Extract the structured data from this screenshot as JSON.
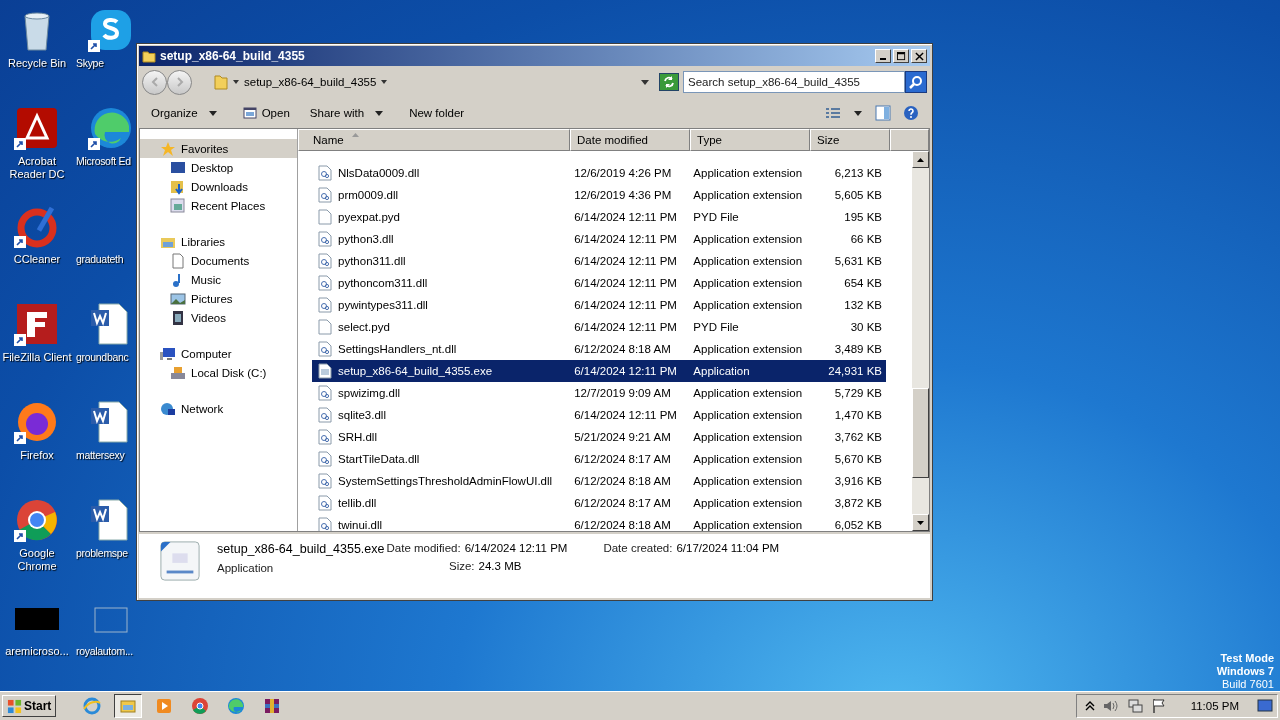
{
  "desktop": {
    "columns": [
      [
        {
          "label": "Recycle Bin",
          "kind": "recycle",
          "shortcut": false
        },
        {
          "label": "Acrobat Reader DC",
          "kind": "acrobat",
          "shortcut": true
        },
        {
          "label": "CCleaner",
          "kind": "ccleaner",
          "shortcut": true
        },
        {
          "label": "FileZilla Client",
          "kind": "filezilla",
          "shortcut": true
        },
        {
          "label": "Firefox",
          "kind": "firefox",
          "shortcut": true
        },
        {
          "label": "Google Chrome",
          "kind": "chrome",
          "shortcut": true
        },
        {
          "label": "aremicroso...",
          "kind": "black",
          "shortcut": false
        }
      ],
      [
        {
          "label": "Skype",
          "kind": "skype",
          "shortcut": true
        },
        {
          "label": "Microsoft Ed",
          "kind": "edge",
          "shortcut": true
        },
        {
          "label": "graduateth",
          "kind": "none",
          "shortcut": false
        },
        {
          "label": "groundbanc",
          "kind": "word",
          "shortcut": false
        },
        {
          "label": "mattersexy",
          "kind": "word",
          "shortcut": false
        },
        {
          "label": "problemspe",
          "kind": "word",
          "shortcut": false
        },
        {
          "label": "royalautom...",
          "kind": "blank",
          "shortcut": false
        }
      ]
    ],
    "watermark_text": [
      "Test Mode",
      "Windows 7",
      "Build 7601"
    ]
  },
  "window": {
    "title": "setup_x86-64_build_4355",
    "address": "setup_x86-64_build_4355",
    "search": {
      "placeholder": "Search setup_x86-64_build_4355"
    },
    "toolbar": [
      {
        "label": "Organize",
        "dropdown": true,
        "kind": "text"
      },
      {
        "label": "Open",
        "dropdown": false,
        "kind": "open"
      },
      {
        "label": "Share with",
        "dropdown": true,
        "kind": "text"
      },
      {
        "label": "New folder",
        "dropdown": false,
        "kind": "text"
      }
    ],
    "nav": [
      {
        "label": "Favorites",
        "kind": "star",
        "selected": true,
        "children": [
          {
            "label": "Desktop",
            "kind": "desktop",
            "selected": false
          },
          {
            "label": "Downloads",
            "kind": "downloads",
            "selected": false
          },
          {
            "label": "Recent Places",
            "kind": "recent",
            "selected": false
          }
        ]
      },
      {
        "label": "Libraries",
        "kind": "library",
        "selected": false,
        "children": [
          {
            "label": "Documents",
            "kind": "documents",
            "selected": false
          },
          {
            "label": "Music",
            "kind": "music",
            "selected": false
          },
          {
            "label": "Pictures",
            "kind": "pictures",
            "selected": false
          },
          {
            "label": "Videos",
            "kind": "videos",
            "selected": false
          }
        ]
      },
      {
        "label": "Computer",
        "kind": "computer",
        "selected": false,
        "children": [
          {
            "label": "Local Disk (C:)",
            "kind": "disk",
            "selected": false
          }
        ]
      },
      {
        "label": "Network",
        "kind": "network",
        "selected": false
      }
    ],
    "columns": [
      {
        "label": "Name",
        "sorted": true
      },
      {
        "label": "Date modified",
        "sorted": false
      },
      {
        "label": "Type",
        "sorted": false
      },
      {
        "label": "Size",
        "sorted": false
      }
    ],
    "rows": [
      {
        "name": "NlsData0009.dll",
        "date": "12/6/2019 4:26 PM",
        "type": "Application extension",
        "size": "6,213 KB",
        "kind": "dll",
        "selected": false
      },
      {
        "name": "prm0009.dll",
        "date": "12/6/2019 4:36 PM",
        "type": "Application extension",
        "size": "5,605 KB",
        "kind": "dll",
        "selected": false
      },
      {
        "name": "pyexpat.pyd",
        "date": "6/14/2024 12:11 PM",
        "type": "PYD File",
        "size": "195 KB",
        "kind": "file",
        "selected": false
      },
      {
        "name": "python3.dll",
        "date": "6/14/2024 12:11 PM",
        "type": "Application extension",
        "size": "66 KB",
        "kind": "dll",
        "selected": false
      },
      {
        "name": "python311.dll",
        "date": "6/14/2024 12:11 PM",
        "type": "Application extension",
        "size": "5,631 KB",
        "kind": "dll",
        "selected": false
      },
      {
        "name": "pythoncom311.dll",
        "date": "6/14/2024 12:11 PM",
        "type": "Application extension",
        "size": "654 KB",
        "kind": "dll",
        "selected": false
      },
      {
        "name": "pywintypes311.dll",
        "date": "6/14/2024 12:11 PM",
        "type": "Application extension",
        "size": "132 KB",
        "kind": "dll",
        "selected": false
      },
      {
        "name": "select.pyd",
        "date": "6/14/2024 12:11 PM",
        "type": "PYD File",
        "size": "30 KB",
        "kind": "file",
        "selected": false
      },
      {
        "name": "SettingsHandlers_nt.dll",
        "date": "6/12/2024 8:18 AM",
        "type": "Application extension",
        "size": "3,489 KB",
        "kind": "dll",
        "selected": false
      },
      {
        "name": "setup_x86-64_build_4355.exe",
        "date": "6/14/2024 12:11 PM",
        "type": "Application",
        "size": "24,931 KB",
        "kind": "exe",
        "selected": true
      },
      {
        "name": "spwizimg.dll",
        "date": "12/7/2019 9:09 AM",
        "type": "Application extension",
        "size": "5,729 KB",
        "kind": "dll",
        "selected": false
      },
      {
        "name": "sqlite3.dll",
        "date": "6/14/2024 12:11 PM",
        "type": "Application extension",
        "size": "1,470 KB",
        "kind": "dll",
        "selected": false
      },
      {
        "name": "SRH.dll",
        "date": "5/21/2024 9:21 AM",
        "type": "Application extension",
        "size": "3,762 KB",
        "kind": "dll",
        "selected": false
      },
      {
        "name": "StartTileData.dll",
        "date": "6/12/2024 8:17 AM",
        "type": "Application extension",
        "size": "5,670 KB",
        "kind": "dll",
        "selected": false
      },
      {
        "name": "SystemSettingsThresholdAdminFlowUI.dll",
        "date": "6/12/2024 8:18 AM",
        "type": "Application extension",
        "size": "3,916 KB",
        "kind": "dll",
        "selected": false
      },
      {
        "name": "tellib.dll",
        "date": "6/12/2024 8:17 AM",
        "type": "Application extension",
        "size": "3,872 KB",
        "kind": "dll",
        "selected": false
      },
      {
        "name": "twinui.dll",
        "date": "6/12/2024 8:18 AM",
        "type": "Application extension",
        "size": "6,052 KB",
        "kind": "dll",
        "selected": false
      }
    ],
    "details": {
      "name": "setup_x86-64_build_4355.exe",
      "type": "Application",
      "modified_label": "Date modified:",
      "modified": "6/14/2024 12:11 PM",
      "created_label": "Date created:",
      "created": "6/17/2024 11:04 PM",
      "size_label": "Size:",
      "size": "24.3 MB"
    }
  },
  "taskbar": {
    "start": "Start",
    "apps": [
      {
        "kind": "ie",
        "active": false
      },
      {
        "kind": "explorer",
        "active": true
      },
      {
        "kind": "media",
        "active": false
      },
      {
        "kind": "chrome",
        "active": false
      },
      {
        "kind": "edge",
        "active": false
      },
      {
        "kind": "winrar",
        "active": false
      }
    ],
    "clock": "11:05 PM"
  }
}
